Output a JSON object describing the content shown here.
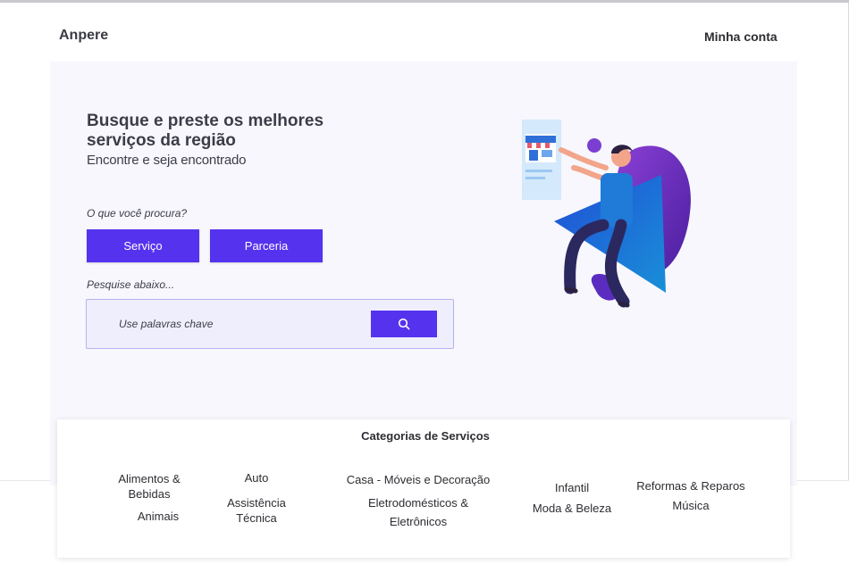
{
  "header": {
    "logo": "Anpere",
    "account_link": "Minha conta"
  },
  "hero": {
    "title": "Busque e preste os melhores serviços da região",
    "subtitle": "Encontre e seja encontrado",
    "question": "O que você procura?",
    "buttons": {
      "servico": "Serviço",
      "parceria": "Parceria"
    },
    "search_label": "Pesquise abaixo...",
    "search_placeholder": "Use palavras chave",
    "illustration_icon": "person-with-storefront-illustration"
  },
  "categories": {
    "title": "Categorias de Serviços",
    "items": [
      "Alimentos & Bebidas",
      "Animais",
      "Auto",
      "Assistência Técnica",
      "Casa - Móveis e Decoração",
      "Eletrodomésticos & Eletrônicos",
      "Infantil",
      "Moda & Beleza",
      "Reformas & Reparos",
      "Música"
    ]
  },
  "colors": {
    "accent": "#5533ee",
    "hero_bg": "#f7f7fd",
    "search_bg": "#efeefc",
    "text": "#3d3d48"
  }
}
